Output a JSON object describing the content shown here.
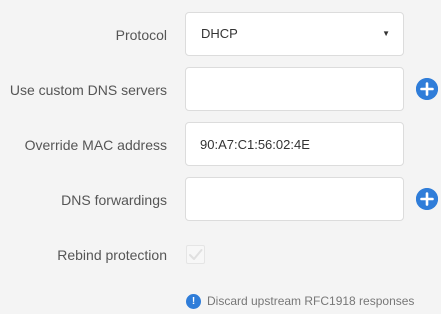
{
  "form": {
    "protocol": {
      "label": "Protocol",
      "value": "DHCP",
      "caret_icon": "caret-down-icon"
    },
    "custom_dns": {
      "label": "Use custom DNS servers",
      "value": "",
      "add_icon": "plus-circle-icon"
    },
    "mac_override": {
      "label": "Override MAC address",
      "value": "90:A7:C1:56:02:4E"
    },
    "dns_forwardings": {
      "label": "DNS forwardings",
      "value": "",
      "add_icon": "plus-circle-icon"
    },
    "rebind_protection": {
      "label": "Rebind protection",
      "checked": true,
      "hint": "Discard upstream RFC1918 responses",
      "hint_icon": "info-icon"
    }
  },
  "colors": {
    "accent": "#2f7dd9",
    "background": "#f4f4f4",
    "label_text": "#555555",
    "checkmark": "#e0e0e0"
  }
}
